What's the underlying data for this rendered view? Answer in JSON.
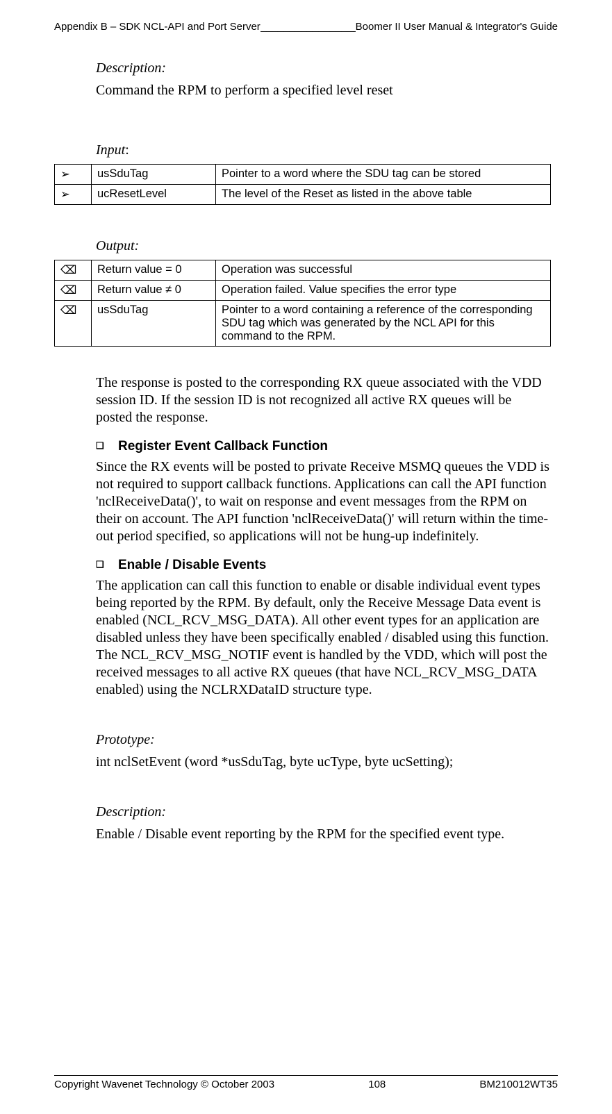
{
  "header": {
    "left": "Appendix B – SDK NCL-API and Port Server",
    "fill": "______________________",
    "right": " Boomer II User Manual & Integrator's Guide"
  },
  "section_description": {
    "label": "Description:",
    "text": "Command the RPM to perform a specified level reset"
  },
  "input": {
    "label": "Input",
    "colon": ":",
    "rows": [
      {
        "bullet": "➢",
        "name": "usSduTag",
        "desc": "Pointer to a word where the SDU tag can be stored"
      },
      {
        "bullet": "➢",
        "name": "ucResetLevel",
        "desc": "The level of the Reset as listed in the above table"
      }
    ]
  },
  "output": {
    "label": "Output:",
    "rows": [
      {
        "bullet": "⌫",
        "name": "Return value = 0",
        "desc": "Operation was successful"
      },
      {
        "bullet": "⌫",
        "name": "Return value  ≠ 0",
        "desc": "Operation failed. Value specifies the error type"
      },
      {
        "bullet": "⌫",
        "name": "usSduTag",
        "desc": "Pointer to a word containing a reference of the corresponding SDU tag which was generated by the NCL API for this command to the RPM."
      }
    ]
  },
  "para_response": "The response is posted to the corresponding RX queue associated with the VDD session ID. If the session ID is not recognized all active RX queues will be posted the response.",
  "heading_register": "Register Event Callback Function",
  "para_register": "Since the RX events will be posted to private Receive MSMQ queues the VDD is not required to support callback functions. Applications can call the API function 'nclReceiveData()', to wait on response and event messages from the RPM on their on account. The API function 'nclReceiveData()' will return within the time-out period specified, so applications will not be hung-up indefinitely.",
  "heading_enable": "Enable / Disable Events",
  "para_enable": "The application can call this function to enable or disable individual event types being reported by the RPM. By default, only the Receive Message Data event is enabled (NCL_RCV_MSG_DATA). All other event types for an application are disabled unless they have been specifically enabled / disabled using this function. The NCL_RCV_MSG_NOTIF event is handled by the VDD, which will post the received messages to all active RX queues (that have NCL_RCV_MSG_DATA enabled) using the NCLRXDataID structure type.",
  "prototype": {
    "label": "Prototype:",
    "text": "int nclSetEvent (word *usSduTag, byte ucType, byte ucSetting);"
  },
  "description2": {
    "label": "Description:",
    "text": "Enable / Disable event reporting by the RPM for the specified event type."
  },
  "footer": {
    "left": "Copyright Wavenet Technology © October 2003",
    "center": "108",
    "right": "BM210012WT35"
  },
  "bullet_square": "❑"
}
